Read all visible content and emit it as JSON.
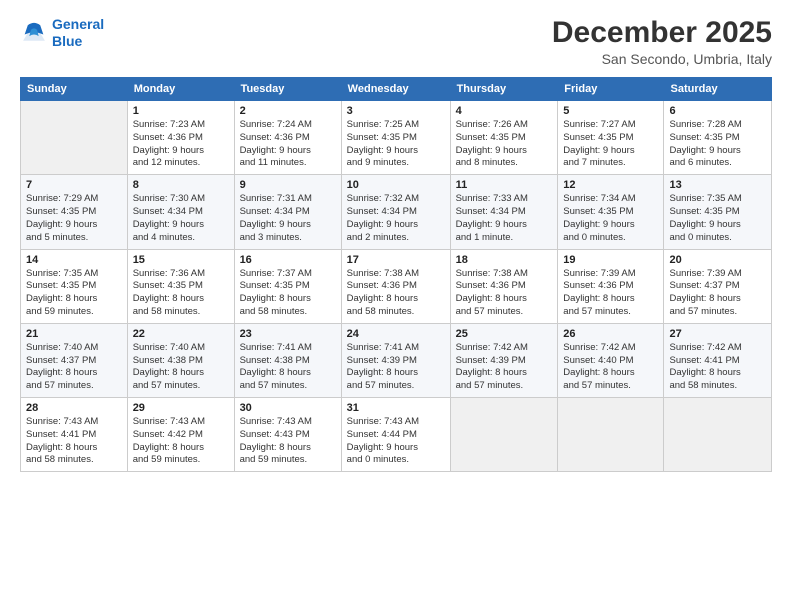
{
  "logo": {
    "line1": "General",
    "line2": "Blue"
  },
  "title": "December 2025",
  "location": "San Secondo, Umbria, Italy",
  "days_of_week": [
    "Sunday",
    "Monday",
    "Tuesday",
    "Wednesday",
    "Thursday",
    "Friday",
    "Saturday"
  ],
  "weeks": [
    [
      {
        "day": "",
        "detail": ""
      },
      {
        "day": "1",
        "detail": "Sunrise: 7:23 AM\nSunset: 4:36 PM\nDaylight: 9 hours\nand 12 minutes."
      },
      {
        "day": "2",
        "detail": "Sunrise: 7:24 AM\nSunset: 4:36 PM\nDaylight: 9 hours\nand 11 minutes."
      },
      {
        "day": "3",
        "detail": "Sunrise: 7:25 AM\nSunset: 4:35 PM\nDaylight: 9 hours\nand 9 minutes."
      },
      {
        "day": "4",
        "detail": "Sunrise: 7:26 AM\nSunset: 4:35 PM\nDaylight: 9 hours\nand 8 minutes."
      },
      {
        "day": "5",
        "detail": "Sunrise: 7:27 AM\nSunset: 4:35 PM\nDaylight: 9 hours\nand 7 minutes."
      },
      {
        "day": "6",
        "detail": "Sunrise: 7:28 AM\nSunset: 4:35 PM\nDaylight: 9 hours\nand 6 minutes."
      }
    ],
    [
      {
        "day": "7",
        "detail": "Sunrise: 7:29 AM\nSunset: 4:35 PM\nDaylight: 9 hours\nand 5 minutes."
      },
      {
        "day": "8",
        "detail": "Sunrise: 7:30 AM\nSunset: 4:34 PM\nDaylight: 9 hours\nand 4 minutes."
      },
      {
        "day": "9",
        "detail": "Sunrise: 7:31 AM\nSunset: 4:34 PM\nDaylight: 9 hours\nand 3 minutes."
      },
      {
        "day": "10",
        "detail": "Sunrise: 7:32 AM\nSunset: 4:34 PM\nDaylight: 9 hours\nand 2 minutes."
      },
      {
        "day": "11",
        "detail": "Sunrise: 7:33 AM\nSunset: 4:34 PM\nDaylight: 9 hours\nand 1 minute."
      },
      {
        "day": "12",
        "detail": "Sunrise: 7:34 AM\nSunset: 4:35 PM\nDaylight: 9 hours\nand 0 minutes."
      },
      {
        "day": "13",
        "detail": "Sunrise: 7:35 AM\nSunset: 4:35 PM\nDaylight: 9 hours\nand 0 minutes."
      }
    ],
    [
      {
        "day": "14",
        "detail": "Sunrise: 7:35 AM\nSunset: 4:35 PM\nDaylight: 8 hours\nand 59 minutes."
      },
      {
        "day": "15",
        "detail": "Sunrise: 7:36 AM\nSunset: 4:35 PM\nDaylight: 8 hours\nand 58 minutes."
      },
      {
        "day": "16",
        "detail": "Sunrise: 7:37 AM\nSunset: 4:35 PM\nDaylight: 8 hours\nand 58 minutes."
      },
      {
        "day": "17",
        "detail": "Sunrise: 7:38 AM\nSunset: 4:36 PM\nDaylight: 8 hours\nand 58 minutes."
      },
      {
        "day": "18",
        "detail": "Sunrise: 7:38 AM\nSunset: 4:36 PM\nDaylight: 8 hours\nand 57 minutes."
      },
      {
        "day": "19",
        "detail": "Sunrise: 7:39 AM\nSunset: 4:36 PM\nDaylight: 8 hours\nand 57 minutes."
      },
      {
        "day": "20",
        "detail": "Sunrise: 7:39 AM\nSunset: 4:37 PM\nDaylight: 8 hours\nand 57 minutes."
      }
    ],
    [
      {
        "day": "21",
        "detail": "Sunrise: 7:40 AM\nSunset: 4:37 PM\nDaylight: 8 hours\nand 57 minutes."
      },
      {
        "day": "22",
        "detail": "Sunrise: 7:40 AM\nSunset: 4:38 PM\nDaylight: 8 hours\nand 57 minutes."
      },
      {
        "day": "23",
        "detail": "Sunrise: 7:41 AM\nSunset: 4:38 PM\nDaylight: 8 hours\nand 57 minutes."
      },
      {
        "day": "24",
        "detail": "Sunrise: 7:41 AM\nSunset: 4:39 PM\nDaylight: 8 hours\nand 57 minutes."
      },
      {
        "day": "25",
        "detail": "Sunrise: 7:42 AM\nSunset: 4:39 PM\nDaylight: 8 hours\nand 57 minutes."
      },
      {
        "day": "26",
        "detail": "Sunrise: 7:42 AM\nSunset: 4:40 PM\nDaylight: 8 hours\nand 57 minutes."
      },
      {
        "day": "27",
        "detail": "Sunrise: 7:42 AM\nSunset: 4:41 PM\nDaylight: 8 hours\nand 58 minutes."
      }
    ],
    [
      {
        "day": "28",
        "detail": "Sunrise: 7:43 AM\nSunset: 4:41 PM\nDaylight: 8 hours\nand 58 minutes."
      },
      {
        "day": "29",
        "detail": "Sunrise: 7:43 AM\nSunset: 4:42 PM\nDaylight: 8 hours\nand 59 minutes."
      },
      {
        "day": "30",
        "detail": "Sunrise: 7:43 AM\nSunset: 4:43 PM\nDaylight: 8 hours\nand 59 minutes."
      },
      {
        "day": "31",
        "detail": "Sunrise: 7:43 AM\nSunset: 4:44 PM\nDaylight: 9 hours\nand 0 minutes."
      },
      {
        "day": "",
        "detail": ""
      },
      {
        "day": "",
        "detail": ""
      },
      {
        "day": "",
        "detail": ""
      }
    ]
  ]
}
